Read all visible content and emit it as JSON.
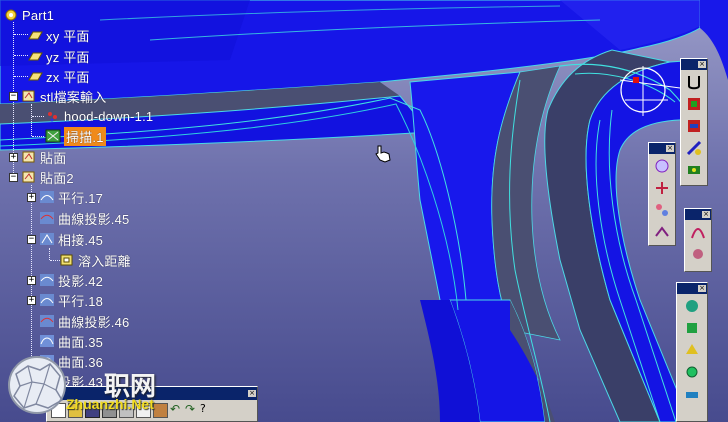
{
  "tree": {
    "root": "Part1",
    "items": [
      {
        "label": "xy 平面"
      },
      {
        "label": "yz 平面"
      },
      {
        "label": "zx 平面"
      },
      {
        "label": "stl檔案輸入"
      },
      {
        "label": "hood-down-1.1"
      },
      {
        "label": "掃描.1"
      },
      {
        "label": "貼面"
      },
      {
        "label": "貼面2"
      },
      {
        "label": "平行.17"
      },
      {
        "label": "曲線投影.45"
      },
      {
        "label": "相接.45"
      },
      {
        "label": "溶入距離"
      },
      {
        "label": "投影.42"
      },
      {
        "label": "平行.18"
      },
      {
        "label": "曲線投影.46"
      },
      {
        "label": "曲面.35"
      },
      {
        "label": "曲面.36"
      },
      {
        "label": "投影.43"
      }
    ]
  },
  "watermark": {
    "cn": "职网",
    "url": "Zhuanzhi.Net"
  },
  "colors": {
    "surface": "#1414e6",
    "edge": "#33dddd",
    "selected": "#f08a1a"
  }
}
